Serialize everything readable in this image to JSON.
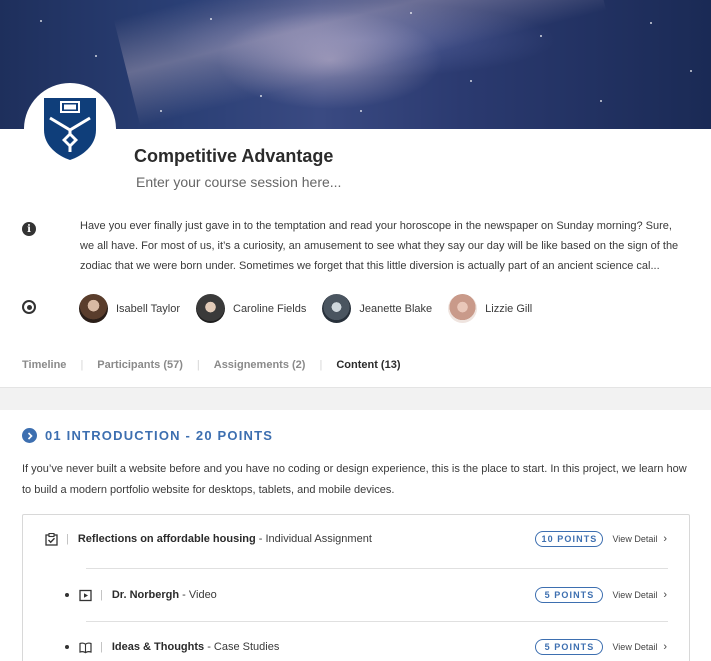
{
  "course": {
    "title": "Competitive Advantage",
    "session_placeholder": "Enter your course session here...",
    "description": "Have you ever finally just gave in to the temptation and read your horoscope in the newspaper on Sunday morning? Sure, we all have. For most of us, it’s a curiosity, an amusement to see what they say our day will be like based on the sign of the zodiac that we were born under. Sometimes we forget that this little diversion is actually part of an ancient science cal..."
  },
  "participants": [
    {
      "name": "Isabell Taylor"
    },
    {
      "name": "Caroline Fields"
    },
    {
      "name": "Jeanette Blake"
    },
    {
      "name": "Lizzie Gill"
    }
  ],
  "tabs": [
    {
      "label": "Timeline",
      "active": false
    },
    {
      "label": "Participants (57)",
      "active": false
    },
    {
      "label": "Assignements (2)",
      "active": false
    },
    {
      "label": "Content (13)",
      "active": true
    }
  ],
  "section": {
    "title": "01 INTRODUCTION - 20 POINTS",
    "description": "If you’ve never built a website before and you have no coding or design experience, this is the place to start. In this project, we learn how to build a modern portfolio website for desktops, tablets, and mobile devices."
  },
  "items": [
    {
      "name": "Reflections on affordable housing",
      "kind": " - Individual Assignment",
      "points": "10 POINTS",
      "view": "View Detail",
      "icon": "assignment-check-icon"
    },
    {
      "name": "Dr. Norbergh",
      "kind": " - Video",
      "points": "5 POINTS",
      "view": "View Detail",
      "icon": "video-play-icon"
    },
    {
      "name": "Ideas & Thoughts",
      "kind": " - Case Studies",
      "points": "5 POINTS",
      "view": "View Detail",
      "icon": "book-icon"
    }
  ],
  "colors": {
    "accent": "#3d6fb0",
    "text": "#2b2b2b",
    "muted": "#8a8a8a"
  }
}
